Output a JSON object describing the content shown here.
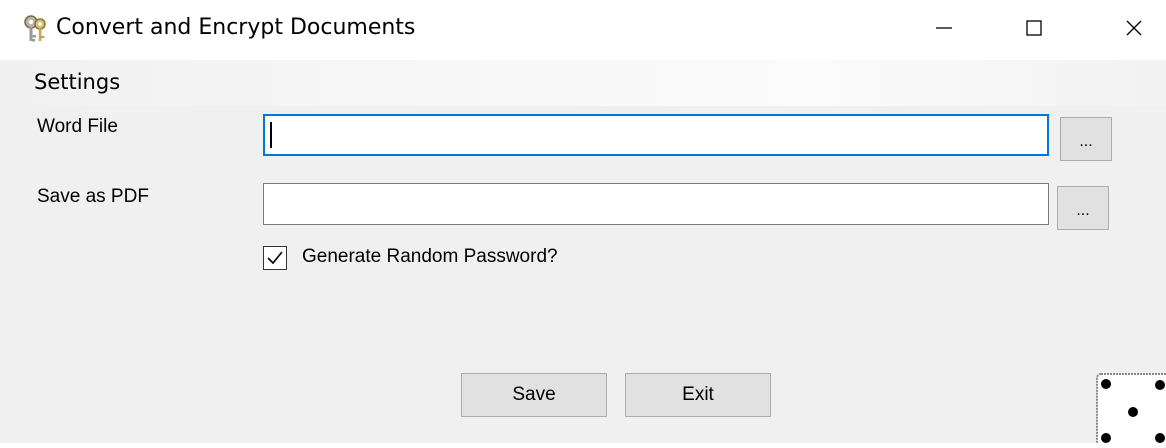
{
  "window": {
    "title": "Convert and Encrypt Documents",
    "icon": "keys-icon",
    "controls": {
      "minimize": "minimize-icon",
      "maximize": "maximize-icon",
      "close": "close-icon"
    }
  },
  "menu": {
    "items": [
      {
        "label": "Settings"
      }
    ]
  },
  "form": {
    "word_file": {
      "label": "Word File",
      "value": "",
      "browse_label": "..."
    },
    "save_as_pdf": {
      "label": "Save as PDF",
      "value": "",
      "browse_label": "..."
    },
    "random_password": {
      "label": "Generate Random Password?",
      "checked": true
    }
  },
  "buttons": {
    "save_label": "Save",
    "exit_label": "Exit"
  },
  "colors": {
    "focus_border": "#0078d7",
    "client_background": "#f0f0f0",
    "button_face": "#e1e1e1"
  }
}
